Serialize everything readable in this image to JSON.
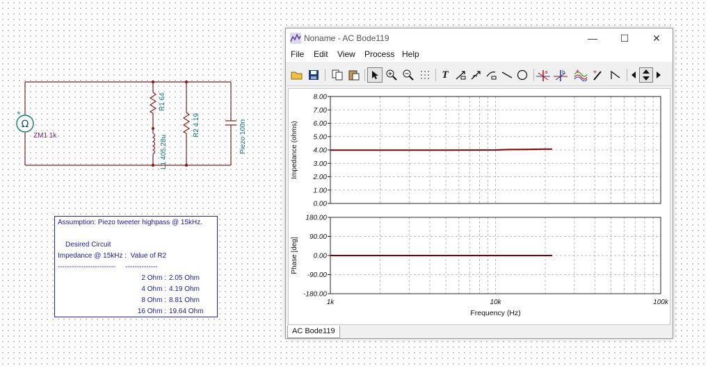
{
  "schematic": {
    "zm1_label": "ZM1 1k",
    "r1_label": "R1 64",
    "l1_label": "L1 405.28u",
    "r2_label": "R2 4.19",
    "c_label": "Piezo 100n",
    "meter_symbol": "Ω",
    "plus_sign": "+"
  },
  "note": {
    "assumption": "Assumption: Piezo tweeter highpass @ 15kHz.",
    "desired": "Desired Circuit",
    "header": "Impedance @ 15kHz :  Value of R2",
    "separator": "-------------------------     --------------",
    "rows": [
      {
        "imp": "2 Ohm :",
        "r2": "2.05 Ohm"
      },
      {
        "imp": "4 Ohm :",
        "r2": "4.19 Ohm"
      },
      {
        "imp": "8 Ohm :",
        "r2": "8.81 Ohm"
      },
      {
        "imp": "16 Ohm :",
        "r2": "19.64 Ohm"
      }
    ]
  },
  "window": {
    "title": "Noname - AC Bode119",
    "minimize_glyph": "—",
    "maximize_glyph": "☐",
    "close_glyph": "✕",
    "menu": [
      "File",
      "Edit",
      "View",
      "Process",
      "Help"
    ],
    "tab_label": "AC Bode119",
    "toolbar_icons": [
      "open-icon",
      "save-icon",
      "copy-icon",
      "paste-icon",
      "pointer-icon",
      "zoom-in-icon",
      "zoom-100-icon",
      "grid-icon",
      "text-icon",
      "arrow-1-icon",
      "arrow-2-icon",
      "arrow-3-icon",
      "line-icon",
      "circle-icon",
      "marker-a-icon",
      "marker-b-icon",
      "curves-icon",
      "pen-icon",
      "angle-icon",
      "scroll-left-icon",
      "scroll-up-down-icon",
      "scroll-right-icon"
    ],
    "accent_color": "#800000"
  },
  "chart_data": [
    {
      "type": "line",
      "ylabel": "Impedance (ohms)",
      "xlabel": "",
      "xscale": "log",
      "xlim": [
        1000,
        100000
      ],
      "ylim": [
        0,
        8
      ],
      "ytick_labels": [
        "8.00",
        "7.00",
        "6.00",
        "5.00",
        "4.00",
        "3.00",
        "2.00",
        "1.00",
        "0.00"
      ],
      "ytick_values": [
        8,
        7,
        6,
        5,
        4,
        3,
        2,
        1,
        0
      ],
      "grid": true,
      "series": [
        {
          "x": [
            1000,
            2000,
            5000,
            10000,
            12000,
            15000,
            20000,
            22000
          ],
          "y": [
            3.99,
            3.99,
            3.99,
            4.0,
            4.03,
            4.04,
            4.06,
            4.07
          ],
          "color": "#800000"
        }
      ]
    },
    {
      "type": "line",
      "ylabel": "Phase [deg]",
      "xlabel": "Frequency (Hz)",
      "xscale": "log",
      "xlim": [
        1000,
        100000
      ],
      "ylim": [
        -180,
        180
      ],
      "ytick_labels": [
        "180.00",
        "90.00",
        "0.00",
        "-90.00",
        "-180.00"
      ],
      "ytick_values": [
        180,
        90,
        0,
        -90,
        -180
      ],
      "xtick_labels": [
        "1k",
        "10k",
        "100k"
      ],
      "xtick_values": [
        1000,
        10000,
        100000
      ],
      "grid": true,
      "series": [
        {
          "x": [
            1000,
            5000,
            10000,
            15000,
            22000
          ],
          "y": [
            0.0,
            0.0,
            0.0,
            0.0,
            0.0
          ],
          "color": "#800000"
        }
      ]
    }
  ]
}
